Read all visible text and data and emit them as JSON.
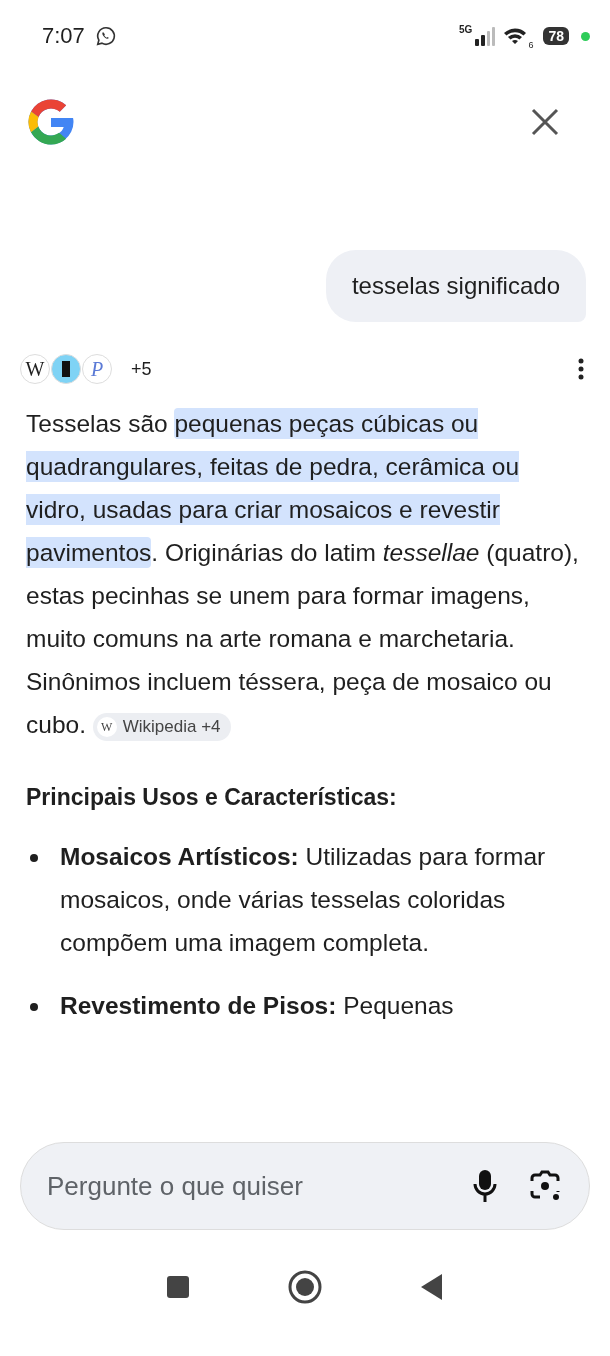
{
  "status_bar": {
    "time": "7:07",
    "network": "5G",
    "wifi_band": "6",
    "battery": "78"
  },
  "query": "tesselas significado",
  "sources": {
    "favicons": [
      {
        "kind": "letter",
        "letter": "W"
      },
      {
        "kind": "bar"
      },
      {
        "kind": "script",
        "letter": "P"
      }
    ],
    "more": "+5"
  },
  "answer": {
    "segments": [
      {
        "text": "Tesselas são ",
        "highlighted": false
      },
      {
        "text": "pequenas peças cúbicas ou quadrangulares, feitas de pedra, cerâmica ou vidro, usadas para criar mosaicos e revestir pavimentos",
        "highlighted": true
      },
      {
        "text": ". Originárias do latim *tessellae* (quatro), estas pecinhas se unem para formar imagens, muito comuns na arte romana e marchetaria. Sinônimos incluem téssera, peça de mosaico ou cubo.",
        "highlighted": false
      }
    ],
    "citation_icon": "W",
    "citation": "Wikipedia +4"
  },
  "section_title": "Principais Usos e Características:",
  "bullets": [
    {
      "term": "Mosaicos Artísticos:",
      "text": "Utilizadas para formar mosaicos, onde várias tesselas coloridas compõem uma imagem completa."
    },
    {
      "term": "Revestimento de Pisos:",
      "text": "Pequenas"
    }
  ],
  "input": {
    "placeholder": "Pergunte o que quiser"
  }
}
